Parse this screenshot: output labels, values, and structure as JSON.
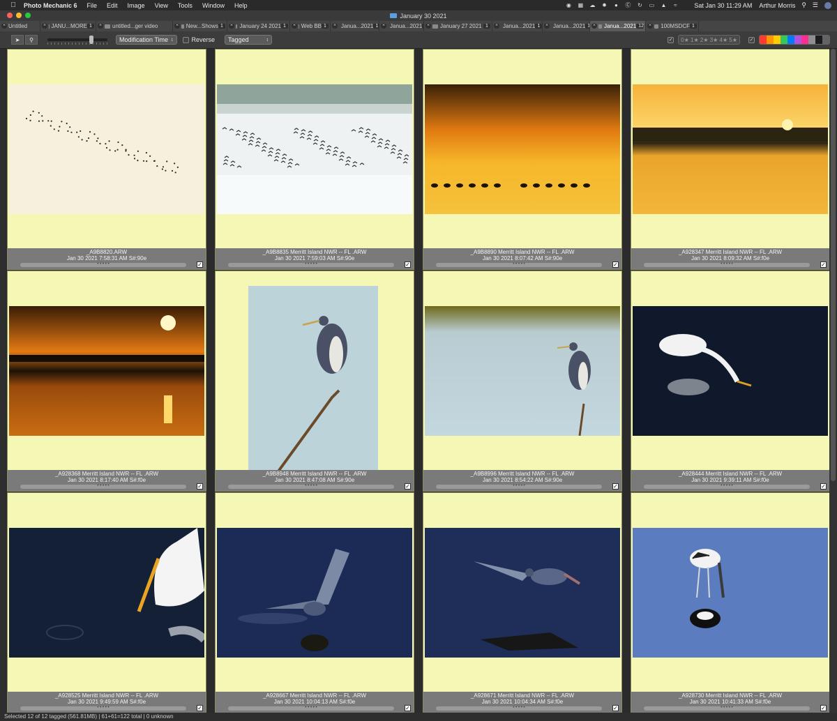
{
  "menubar": {
    "app_name": "Photo Mechanic 6",
    "menus": [
      "File",
      "Edit",
      "Image",
      "View",
      "Tools",
      "Window",
      "Help"
    ],
    "clock": "Sat Jan 30  11:29 AM",
    "user": "Arthur Morris"
  },
  "window": {
    "title": "January 30 2021"
  },
  "tabs": [
    {
      "label": "Untitled",
      "count": ""
    },
    {
      "label": "JANU...MORE",
      "count": "1"
    },
    {
      "label": "untitled...ger video",
      "count": ""
    },
    {
      "label": "New...Shows",
      "count": "1"
    },
    {
      "label": "January 24 2021",
      "count": "1"
    },
    {
      "label": "Web BB",
      "count": "1"
    },
    {
      "label": "Janua...2021",
      "count": "1"
    },
    {
      "label": "Janua...2021",
      "count": "1"
    },
    {
      "label": "January 27 2021",
      "count": "1"
    },
    {
      "label": "Janua...2021",
      "count": "1"
    },
    {
      "label": "Janua...2021",
      "count": "1"
    },
    {
      "label": "Janua...2021",
      "count": "12"
    },
    {
      "label": "100MSDCF",
      "count": "1"
    }
  ],
  "toolbar": {
    "sort_by": "Modification Time",
    "reverse_label": "Reverse",
    "filter": "Tagged",
    "stars_label": "0★ 1★ 2★ 3★ 4★ 5★",
    "color_swatches": [
      "#ff3b30",
      "#ff9500",
      "#ffcc00",
      "#34c759",
      "#007aff",
      "#af52de",
      "#ff2d92",
      "#8e8e93",
      "#1c1c1e",
      "#636366"
    ]
  },
  "photos": [
    {
      "file": "_A9B8820.ARW",
      "date": "Jan 30 2021 7:58:31 AM S#:90e",
      "scene": "flock"
    },
    {
      "file": "_A9B8835  Merritt Island NWR -- FL .ARW",
      "date": "Jan 30 2021 7:59:03 AM S#:90e",
      "scene": "mist"
    },
    {
      "file": "_A9B8890  Merritt Island NWR -- FL .ARW",
      "date": "Jan 30 2021 8:07:42 AM S#:90e",
      "scene": "gold"
    },
    {
      "file": "_A928347  Merritt Island NWR -- FL .ARW",
      "date": "Jan 30 2021 8:09:32 AM S#:f0e",
      "scene": "sunrise"
    },
    {
      "file": "_A928368  Merritt Island NWR -- FL .ARW",
      "date": "Jan 30 2021 8:17:40 AM S#:f0e",
      "scene": "sun"
    },
    {
      "file": "_A9B8948  Merritt Island NWR -- FL .ARW",
      "date": "Jan 30 2021 8:47:08 AM S#:90e",
      "scene": "heron-vert"
    },
    {
      "file": "_A9B8996  Merritt Island NWR -- FL .ARW",
      "date": "Jan 30 2021 8:54:22 AM S#:90e",
      "scene": "heron-horiz"
    },
    {
      "file": "_A928444  Merritt Island NWR -- FL .ARW",
      "date": "Jan 30 2021 9:39:11 AM S#:f0e",
      "scene": "egret"
    },
    {
      "file": "_A928525  Merritt Island NWR -- FL .ARW",
      "date": "Jan 30 2021 9:49:59 AM S#:f0e",
      "scene": "egret-close"
    },
    {
      "file": "_A928667  Merritt Island NWR -- FL .ARW",
      "date": "Jan 30 2021 10:04:13 AM S#:f0e",
      "scene": "heron-splash"
    },
    {
      "file": "_A928671  Merritt Island NWR -- FL .ARW",
      "date": "Jan 30 2021 10:04:34 AM S#:f0e",
      "scene": "heron-run"
    },
    {
      "file": "_A928730  Merritt Island NWR -- FL .ARW",
      "date": "Jan 30 2021 10:41:33 AM S#:f0e",
      "scene": "stork"
    }
  ],
  "rating_dots": "• • • • •",
  "status": "Selected 12 of 12 tagged (561.81MB) | 61+61=122 total | 0 unknown"
}
